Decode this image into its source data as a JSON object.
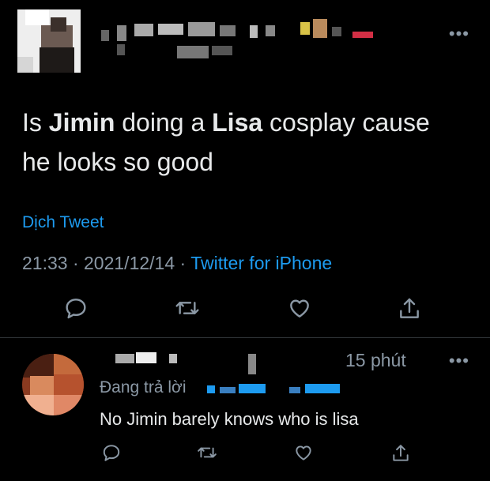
{
  "tweet": {
    "text_parts": [
      "Is ",
      "Jimin",
      " doing a ",
      "Lisa",
      " cosplay cause",
      "he looks so good"
    ],
    "translate_label": "Dịch Tweet",
    "time": "21:33",
    "separator": "·",
    "date": "2021/12/14",
    "source": "Twitter for iPhone",
    "more_icon": "more-horizontal-icon",
    "actions": [
      "reply-icon",
      "retweet-icon",
      "like-icon",
      "share-icon"
    ]
  },
  "reply": {
    "time": "15 phút",
    "replying_label": "Đang trả lời",
    "text": "No Jimin barely knows who is lisa",
    "more_icon": "more-horizontal-icon",
    "actions": [
      "reply-icon",
      "retweet-icon",
      "like-icon",
      "share-icon"
    ]
  },
  "colors": {
    "background": "#000000",
    "text": "#e7e9ea",
    "muted": "#8b98a5",
    "link": "#1d9bf0"
  }
}
